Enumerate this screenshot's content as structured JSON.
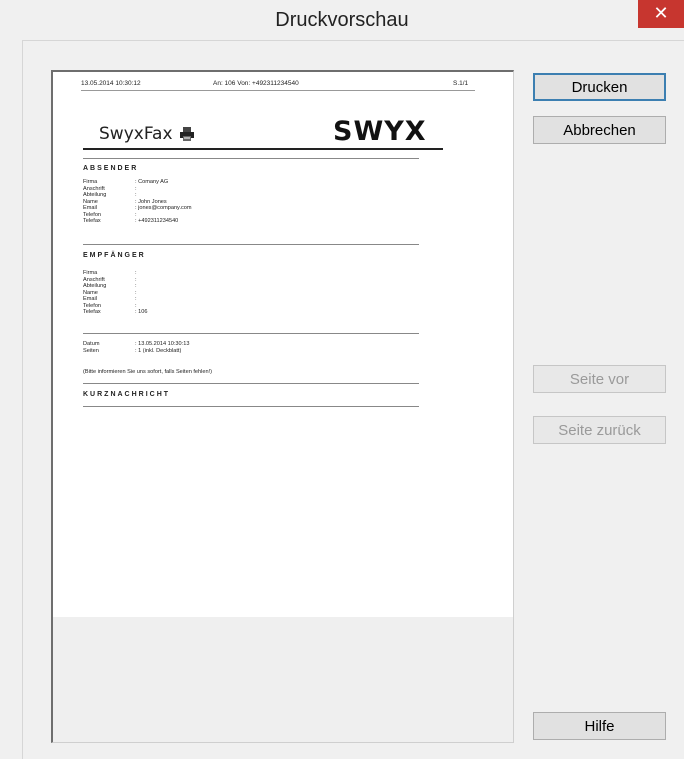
{
  "window": {
    "title": "Druckvorschau",
    "close_label": "✕"
  },
  "page": {
    "header": {
      "datetime": "13.05.2014 10:30:12",
      "recipient": "An: 106 Von: +492311234540",
      "page": "S.1/1"
    },
    "logo_text": "SwyxFax",
    "brand": "SWYX",
    "sender": {
      "title": "ABSENDER",
      "rows": [
        {
          "label": "Firma",
          "value": ": Comany AG"
        },
        {
          "label": "Anschrift",
          "value": ":"
        },
        {
          "label": "Abteilung",
          "value": ":"
        },
        {
          "label": "Name",
          "value": ": John Jones"
        },
        {
          "label": "Email",
          "value": ": jones@company.com"
        },
        {
          "label": "Telefon",
          "value": ":"
        },
        {
          "label": "Telefax",
          "value": ": +492311234540"
        }
      ]
    },
    "recipient_section": {
      "title": "EMPFÄNGER",
      "rows": [
        {
          "label": "Firma",
          "value": ":"
        },
        {
          "label": "Anschrift",
          "value": ":"
        },
        {
          "label": "Abteilung",
          "value": ":"
        },
        {
          "label": "Name",
          "value": ":"
        },
        {
          "label": "Email",
          "value": ":"
        },
        {
          "label": "Telefon",
          "value": ":"
        },
        {
          "label": "Telefax",
          "value": ": 106"
        }
      ]
    },
    "meta": {
      "rows": [
        {
          "label": "Datum",
          "value": ": 13.05.2014 10:30:13"
        },
        {
          "label": "Seiten",
          "value": ": 1        (inkl. Deckblatt)"
        }
      ],
      "note": "(Bitte informieren Sie uns sofort, falls Seiten fehlen!)"
    },
    "short_message": {
      "title": "KURZNACHRICHT"
    }
  },
  "buttons": {
    "print": "Drucken",
    "cancel": "Abbrechen",
    "next_page": "Seite vor",
    "prev_page": "Seite zurück",
    "help": "Hilfe"
  }
}
